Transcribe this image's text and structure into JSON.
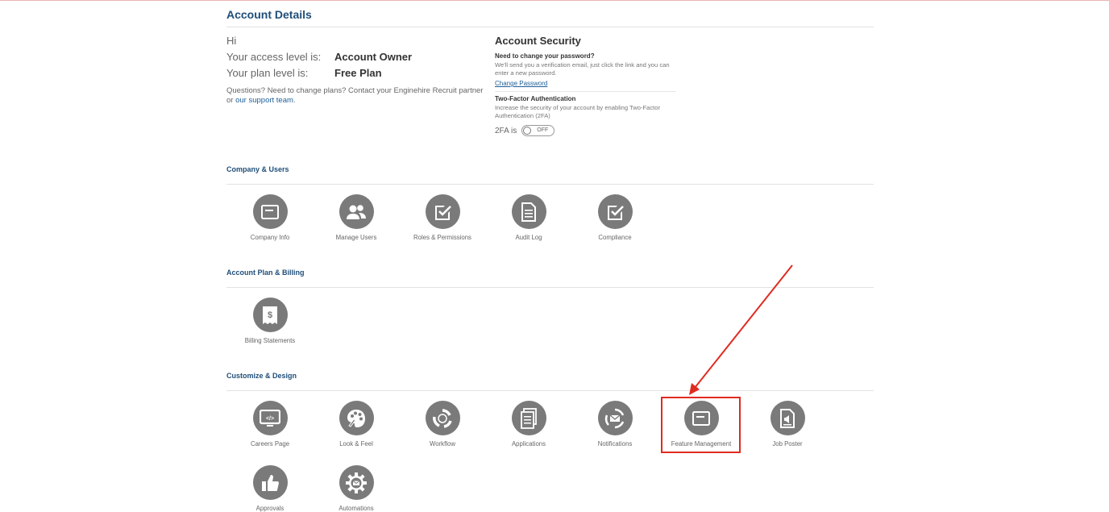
{
  "header": {
    "title": "Account Details"
  },
  "account": {
    "greeting": "Hi",
    "access_label": "Your access level is:",
    "access_value": "Account Owner",
    "plan_label": "Your plan level is:",
    "plan_value": "Free Plan",
    "questions_text": "Questions? Need to change plans? Contact your Enginehire Recruit partner or ",
    "support_link": "our support team",
    "questions_end": "."
  },
  "security": {
    "title": "Account Security",
    "password_heading": "Need to change your password?",
    "password_desc": "We'll send you a verification email, just click the link and you can enter a new password.",
    "password_link": "Change Password",
    "tfa_heading": "Two-Factor Authentication",
    "tfa_desc": "Increase the security of your account by enabling Two-Factor Authentication (2FA)",
    "tfa_label": "2FA is",
    "tfa_state": "OFF"
  },
  "sections": {
    "company": {
      "title": "Company & Users",
      "items": [
        {
          "label": "Company Info",
          "icon": "company-info-icon"
        },
        {
          "label": "Manage Users",
          "icon": "users-icon"
        },
        {
          "label": "Roles & Permissions",
          "icon": "roles-icon"
        },
        {
          "label": "Audit Log",
          "icon": "audit-log-icon"
        },
        {
          "label": "Compliance",
          "icon": "compliance-icon"
        }
      ]
    },
    "billing": {
      "title": "Account Plan & Billing",
      "items": [
        {
          "label": "Billing Statements",
          "icon": "billing-icon"
        }
      ]
    },
    "customize": {
      "title": "Customize & Design",
      "items": [
        {
          "label": "Careers Page",
          "icon": "careers-page-icon"
        },
        {
          "label": "Look & Feel",
          "icon": "palette-icon"
        },
        {
          "label": "Workflow",
          "icon": "workflow-icon"
        },
        {
          "label": "Applications",
          "icon": "applications-icon"
        },
        {
          "label": "Notifications",
          "icon": "notifications-icon"
        },
        {
          "label": "Feature Management",
          "icon": "feature-management-icon"
        },
        {
          "label": "Job Poster",
          "icon": "job-poster-icon"
        },
        {
          "label": "Approvals",
          "icon": "thumbs-up-icon"
        },
        {
          "label": "Automations",
          "icon": "gear-icon"
        }
      ]
    }
  },
  "colors": {
    "accent": "#1f4e79",
    "link": "#1f5f99",
    "icon_bg": "#7a7a7a",
    "annotation": "#e02b20"
  }
}
